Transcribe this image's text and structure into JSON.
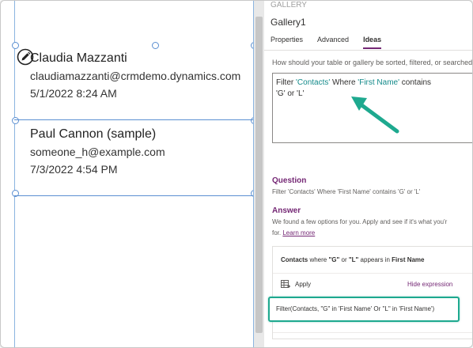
{
  "canvas": {
    "rows": [
      {
        "name": "Claudia Mazzanti",
        "email": "claudiamazzanti@crmdemo.dynamics.com",
        "date": "5/1/2022 8:24 AM"
      },
      {
        "name": "Paul Cannon (sample)",
        "email": "someone_h@example.com",
        "date": "7/3/2022 4:54 PM"
      }
    ],
    "edit_icon": "pencil-icon"
  },
  "panel": {
    "top_label": "GALLERY",
    "title": "Gallery1",
    "tabs": [
      {
        "label": "Properties",
        "active": false
      },
      {
        "label": "Advanced",
        "active": false
      },
      {
        "label": "Ideas",
        "active": true
      }
    ],
    "prompt": "How should your table or gallery be sorted, filtered, or searched",
    "query": {
      "p1": "Filter ",
      "t1": "'Contacts'",
      "p2": " Where ",
      "t2": "'First Name'",
      "p3": " contains",
      "line2": "'G' or 'L'"
    },
    "question": {
      "heading": "Question",
      "text": "Filter 'Contacts' Where 'First Name' contains 'G' or 'L'"
    },
    "answer": {
      "heading": "Answer",
      "line1": "We found a few options for you. Apply and see if it's what you'r",
      "line2_prefix": "for. ",
      "learn_more": "Learn more"
    },
    "suggestion": {
      "c1": "Contacts",
      "c2": " where ",
      "c3": "\"G\"",
      "c4": " or ",
      "c5": "\"L\"",
      "c6": " appears in ",
      "c7": "First Name",
      "apply_label": "Apply",
      "hide_label": "Hide expression",
      "expression": "Filter(Contacts, \"G\" in 'First Name' Or \"L\" in 'First Name')"
    }
  },
  "colors": {
    "accent_purple": "#742774",
    "teal": "#138a8a",
    "highlight": "#1ea98f",
    "guide_blue": "#5b8fd1"
  }
}
